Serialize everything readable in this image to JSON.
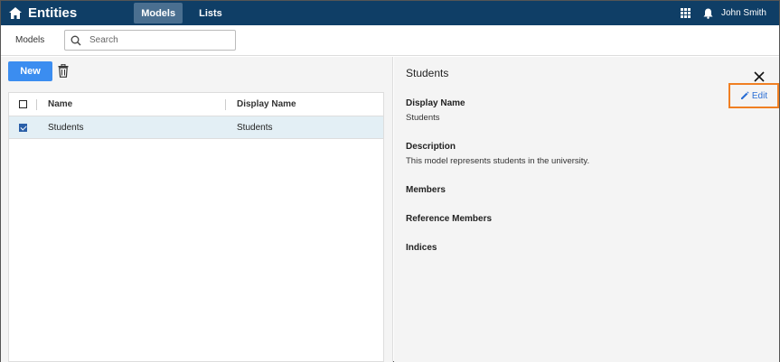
{
  "topbar": {
    "title": "Entities",
    "tabs": [
      {
        "label": "Models",
        "active": true
      },
      {
        "label": "Lists",
        "active": false
      }
    ],
    "user": "John Smith",
    "icons": [
      "home-icon",
      "apps-grid-icon",
      "bell-icon"
    ],
    "color": "#0f3e66"
  },
  "subbar": {
    "breadcrumb": "Models",
    "search": {
      "placeholder": "Search",
      "value": ""
    }
  },
  "toolbar": {
    "new_label": "New",
    "new_color": "#3b8df0"
  },
  "table": {
    "columns": [
      "Name",
      "Display Name"
    ],
    "rows": [
      {
        "name": "Students",
        "display_name": "Students",
        "checked": true
      }
    ]
  },
  "detail": {
    "title": "Students",
    "edit_label": "Edit",
    "highlight_color": "#f07f22",
    "fields": [
      {
        "label": "Display Name",
        "value": "Students"
      },
      {
        "label": "Description",
        "value": "This model represents students in the university."
      },
      {
        "label": "Members",
        "value": ""
      },
      {
        "label": "Reference Members",
        "value": ""
      },
      {
        "label": "Indices",
        "value": ""
      }
    ]
  }
}
